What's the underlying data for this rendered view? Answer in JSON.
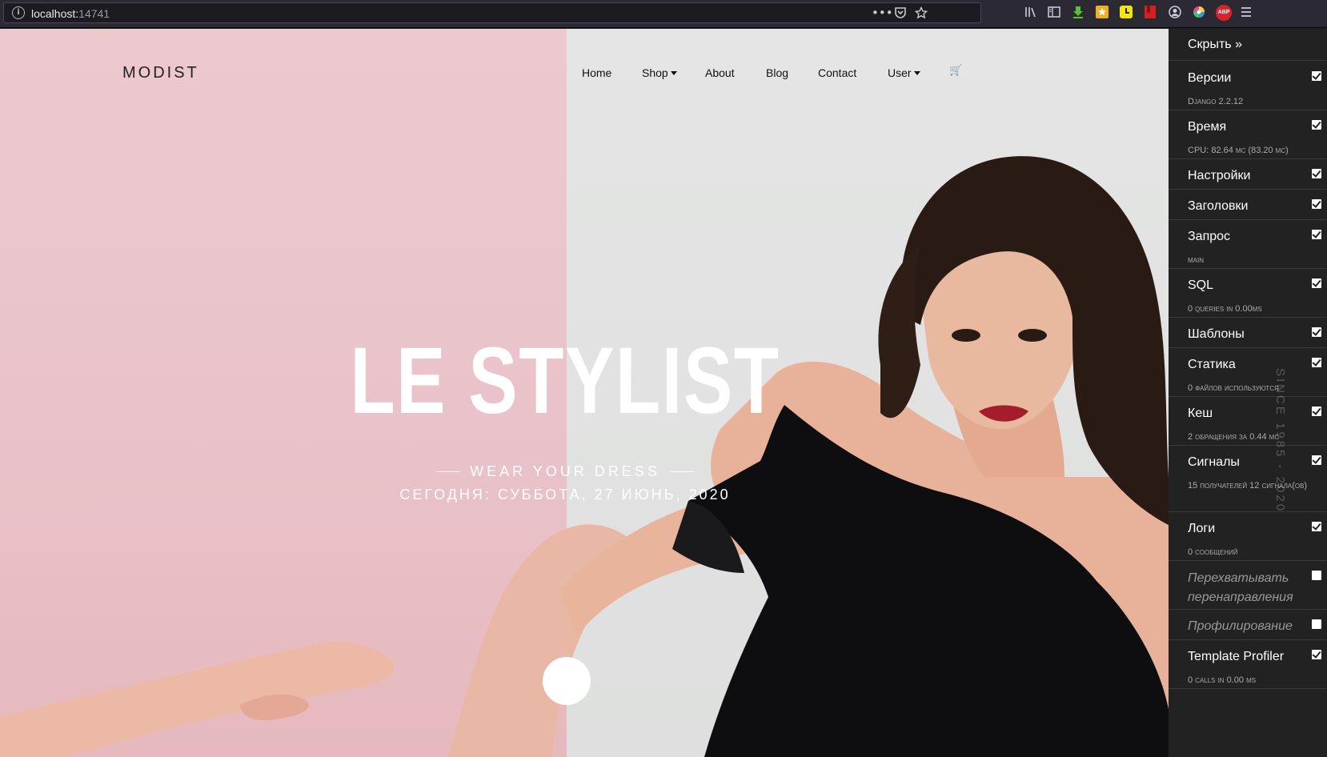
{
  "browser": {
    "url_host": "localhost:",
    "url_port": "14741",
    "ellipsis": "•••",
    "toolbar_icons": [
      "pocket-icon",
      "star-icon",
      "library-icon",
      "sidebar-icon",
      "download-icon",
      "extension-icon",
      "clock-icon",
      "bookmark-icon",
      "account-icon",
      "color-icon",
      "abp-icon",
      "menu-icon"
    ],
    "abp_label": "ABP"
  },
  "site": {
    "brand": "MODIST",
    "nav": {
      "home": "Home",
      "shop": "Shop",
      "about": "About",
      "blog": "Blog",
      "contact": "Contact",
      "user": "User",
      "cart_icon": "🛒"
    },
    "hero": {
      "title": "LE STYLIST",
      "subtitle": "WEAR YOUR DRESS",
      "date": "СЕГОДНЯ: СУББОТА, 27 ИЮНЬ, 2020",
      "since": "SINCE 1985 - 2020"
    }
  },
  "debug_toolbar": {
    "hide_label": "Скрыть »",
    "panels": [
      {
        "title": "Версии",
        "subtitle": "Django 2.2.12",
        "checked": true
      },
      {
        "title": "Время",
        "subtitle": "CPU: 82.64 мс (83.20 мс)",
        "checked": true
      },
      {
        "title": "Настройки",
        "subtitle": "",
        "checked": true
      },
      {
        "title": "Заголовки",
        "subtitle": "",
        "checked": true
      },
      {
        "title": "Запрос",
        "subtitle": "main",
        "checked": true
      },
      {
        "title": "SQL",
        "subtitle": "0 queries in 0.00ms",
        "checked": true
      },
      {
        "title": "Шаблоны",
        "subtitle": "",
        "checked": true
      },
      {
        "title": "Статика",
        "subtitle": "0 файлов используются",
        "checked": true
      },
      {
        "title": "Кеш",
        "subtitle": "2 обращения за 0.44 мс",
        "checked": true
      },
      {
        "title": "Сигналы",
        "subtitle": "15 получателей 12 сигнала(ов)",
        "checked": true
      },
      {
        "title": "Логи",
        "subtitle": "0 сообщений",
        "checked": true
      },
      {
        "title": "Перехватывать перенаправления",
        "subtitle": "",
        "checked": false
      },
      {
        "title": "Профилирование",
        "subtitle": "",
        "checked": false
      },
      {
        "title": "Template Profiler",
        "subtitle": "0 calls in 0.00 ms",
        "checked": true
      }
    ]
  }
}
